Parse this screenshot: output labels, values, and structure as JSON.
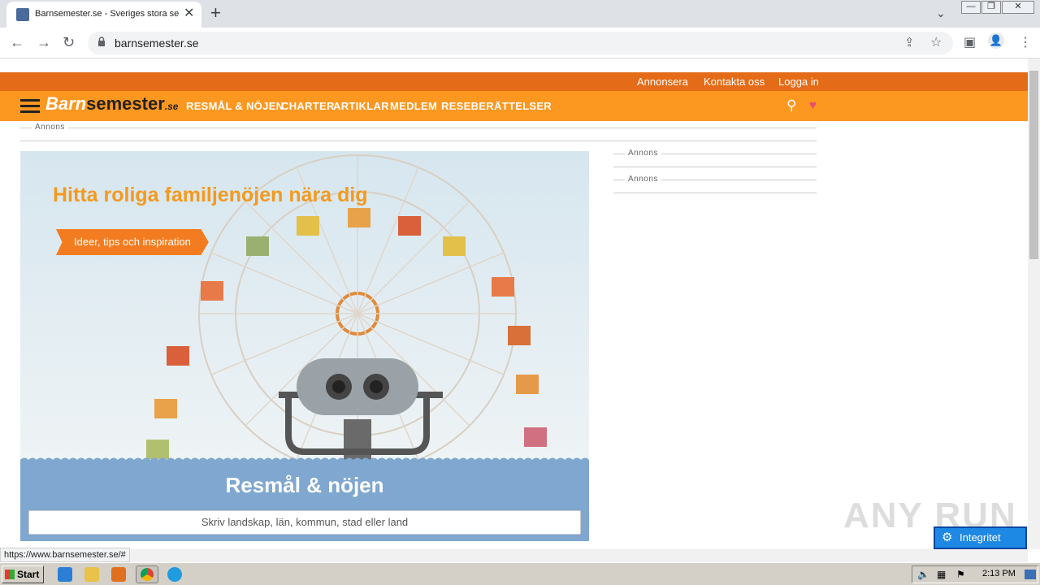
{
  "browser": {
    "tab_title": "Barnsemester.se - Sveriges stora se",
    "url": "barnsemester.se",
    "status_url": "https://www.barnsemester.se/#"
  },
  "site": {
    "topbar": {
      "advertise": "Annonsera",
      "contact": "Kontakta oss",
      "login": "Logga in"
    },
    "logo": {
      "part1": "Barn",
      "part2": "semester",
      "suffix": ".se"
    },
    "nav": [
      "RESMÅL & NÖJEN",
      "CHARTER",
      "ARTIKLAR",
      "MEDLEM",
      "RESEBERÄTTELSER"
    ],
    "ad_label": "Annons",
    "hero": {
      "title": "Hitta roliga familjenöjen nära dig",
      "cta": "Ideer, tips och inspiration"
    },
    "search_panel": {
      "title": "Resmål & nöjen",
      "placeholder": "Skriv landskap, län, kommun, stad eller land"
    },
    "privacy_button": "Integritet"
  },
  "watermark": "ANY RUN",
  "taskbar": {
    "start": "Start",
    "clock": "2:13 PM"
  },
  "colors": {
    "topbar": "#e46b17",
    "nav": "#fc9720",
    "panel": "#7fa7cf",
    "cta": "#f47c20"
  }
}
